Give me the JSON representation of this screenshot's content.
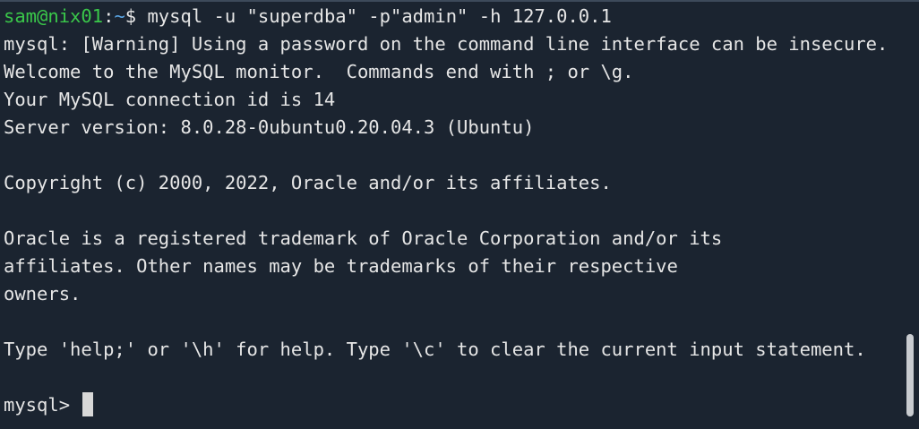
{
  "terminal": {
    "command_line": {
      "user_host": "sam@nix01",
      "separator": ":",
      "path": "~",
      "symbol": "$",
      "command": " mysql -u \"superdba\" -p\"admin\" -h 127.0.0.1"
    },
    "lines": [
      "mysql: [Warning] Using a password on the command line interface can be insecure.",
      "Welcome to the MySQL monitor.  Commands end with ; or \\g.",
      "Your MySQL connection id is 14",
      "Server version: 8.0.28-0ubuntu0.20.04.3 (Ubuntu)",
      "",
      "Copyright (c) 2000, 2022, Oracle and/or its affiliates.",
      "",
      "Oracle is a registered trademark of Oracle Corporation and/or its",
      "affiliates. Other names may be trademarks of their respective",
      "owners.",
      "",
      "Type 'help;' or '\\h' for help. Type '\\c' to clear the current input statement.",
      ""
    ],
    "mysql_prompt": "mysql> "
  },
  "colors": {
    "background": "#1b2430",
    "text": "#e6e6e6",
    "prompt_user": "#3ac84a",
    "prompt_path": "#5aa6e6"
  }
}
